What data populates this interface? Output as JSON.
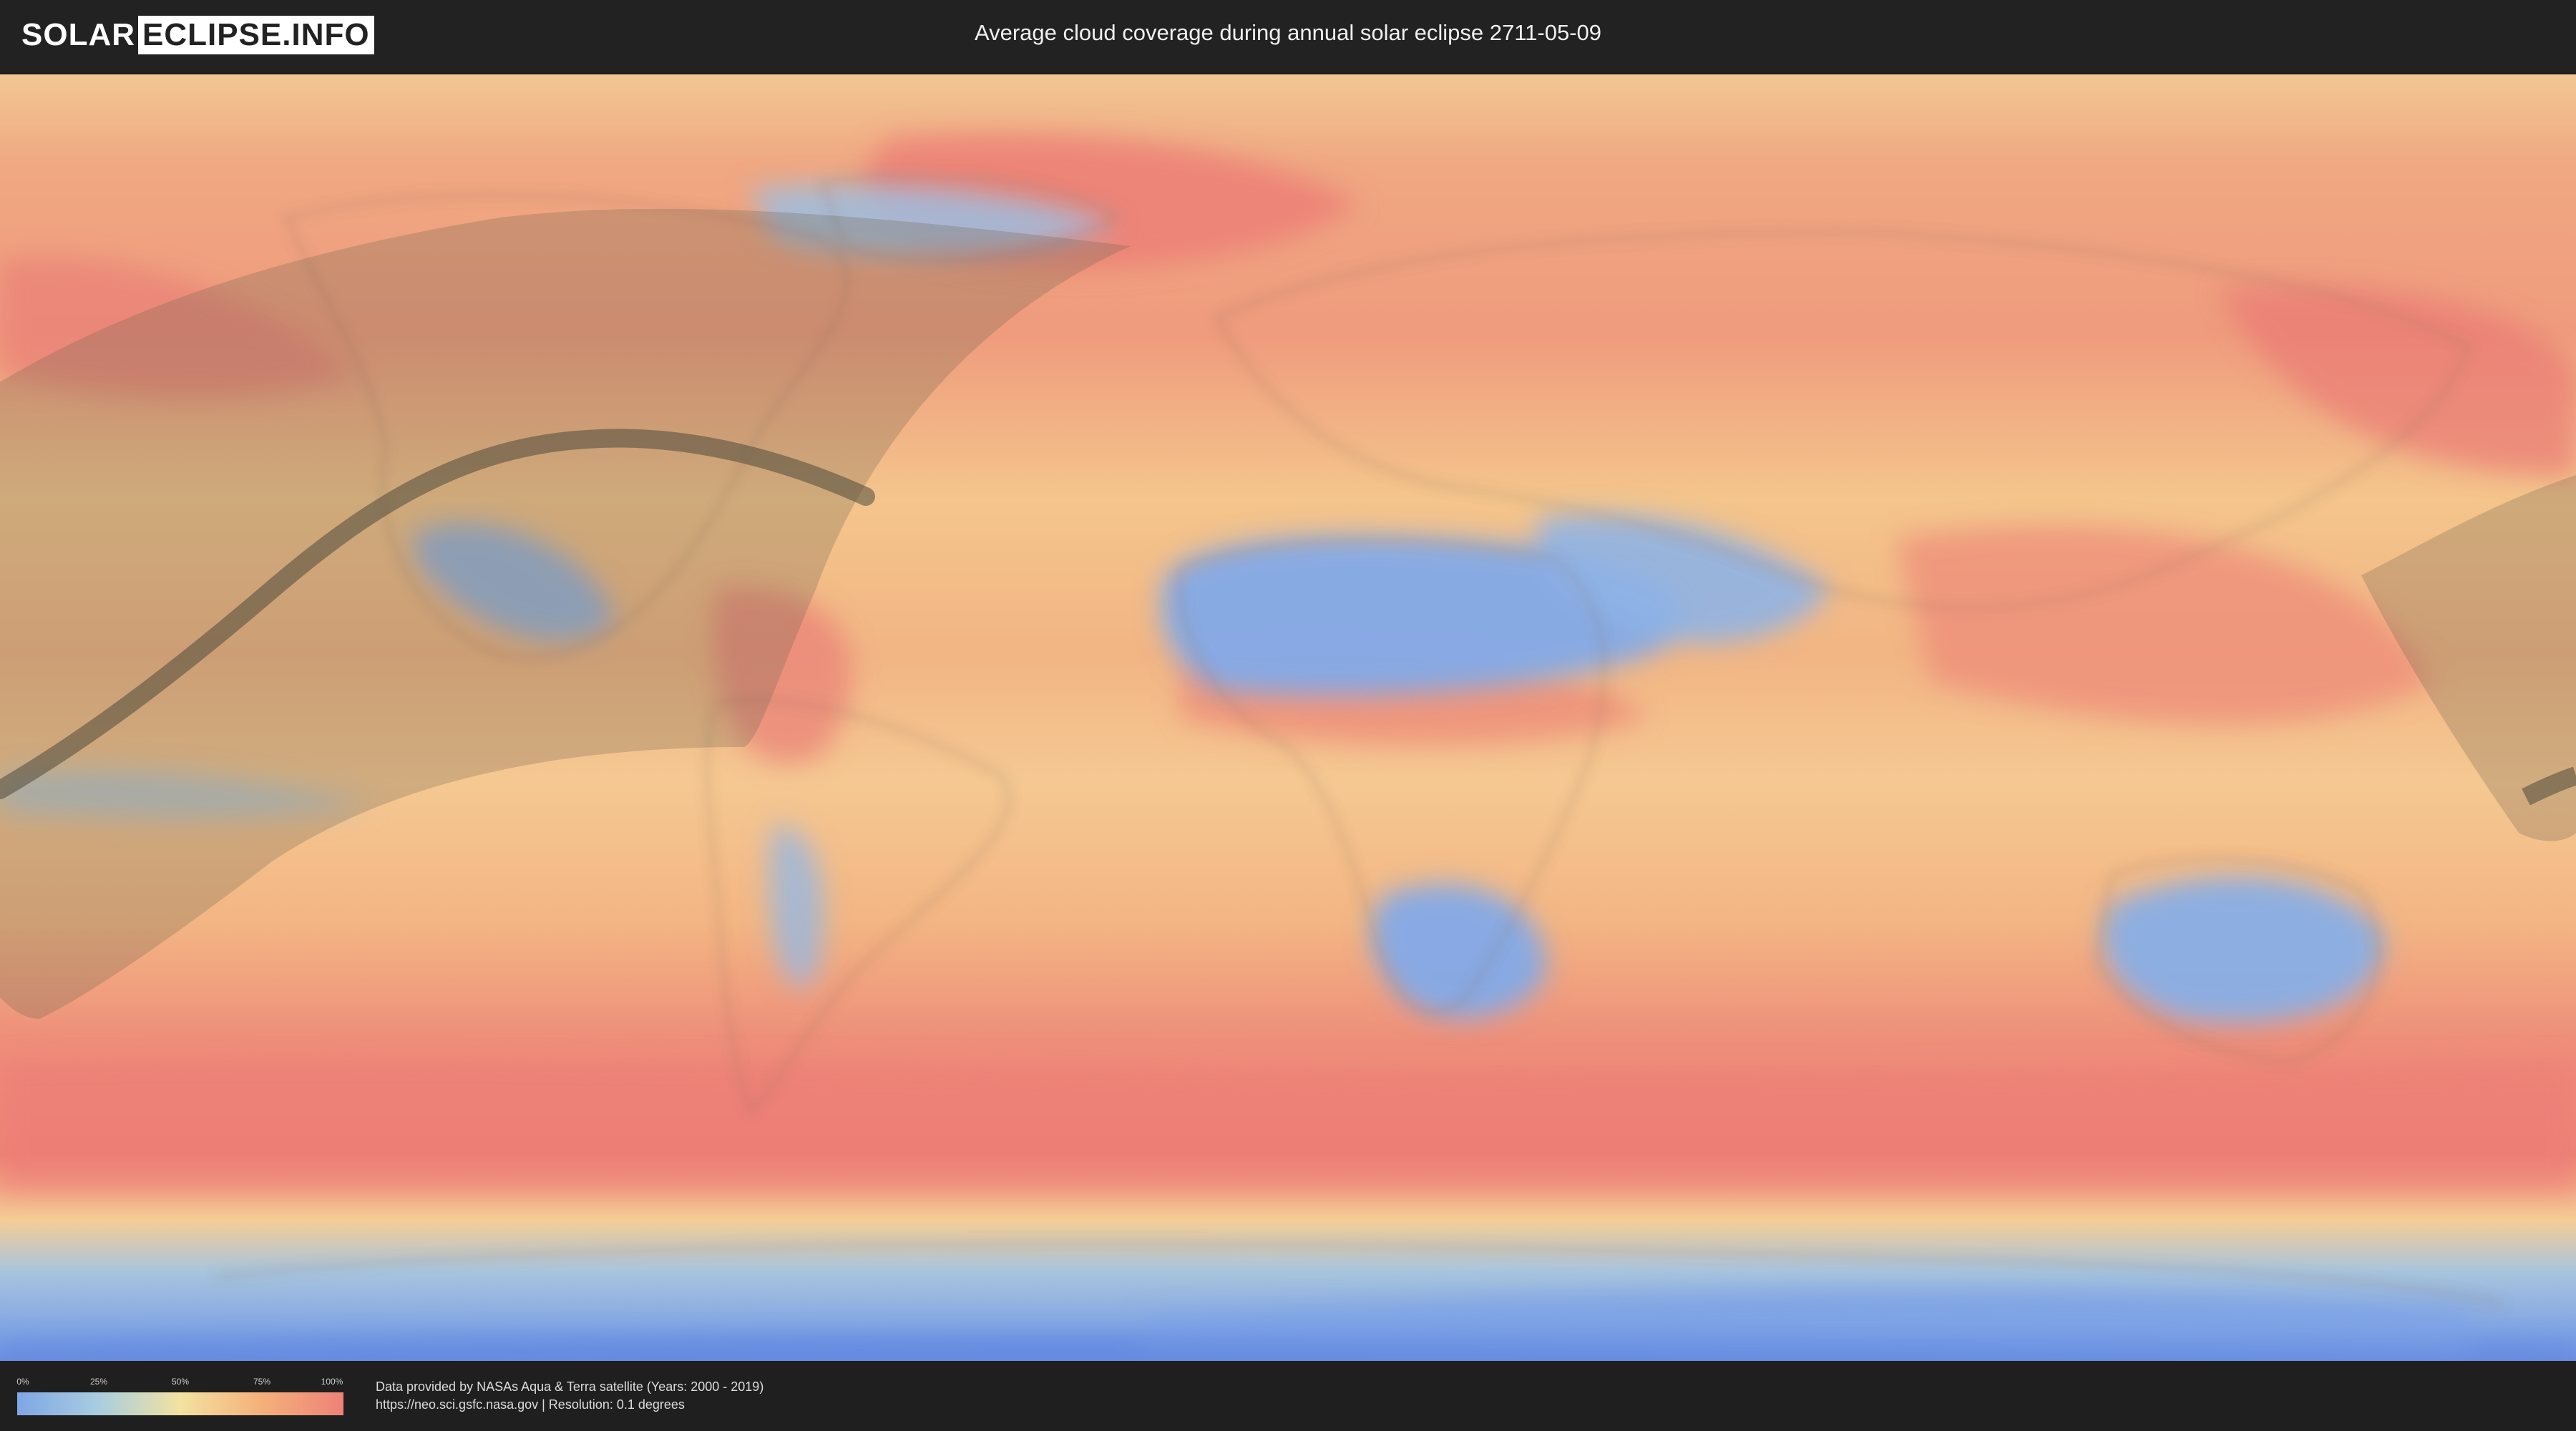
{
  "header": {
    "logo_left": "SOLAR",
    "logo_right": "ECLIPSE.INFO",
    "title": "Average cloud coverage during annual solar eclipse 2711-05-09"
  },
  "map": {
    "projection": "equirectangular world map",
    "layers": [
      "cloud-coverage-heatmap",
      "country-borders",
      "eclipse-visibility-zone",
      "annularity-path"
    ],
    "colors": {
      "low_cloud": "#7fa6e6",
      "mid_cloud": "#f3e2a0",
      "high_cloud": "#ee8278",
      "eclipse_shading": "#6e6650",
      "central_path": "#4f4a3c"
    }
  },
  "legend": {
    "ticks": [
      "0%",
      "25%",
      "50%",
      "75%",
      "100%"
    ],
    "gradient_colors": [
      "#7fa6e6",
      "#a9cde0",
      "#f3e2a0",
      "#f5b07a",
      "#ee8278"
    ]
  },
  "footer": {
    "source_line": "Data provided by NASAs Aqua & Terra satellite (Years: 2000 - 2019)",
    "url_line": "https://neo.sci.gsfc.nasa.gov | Resolution: 0.1 degrees"
  }
}
